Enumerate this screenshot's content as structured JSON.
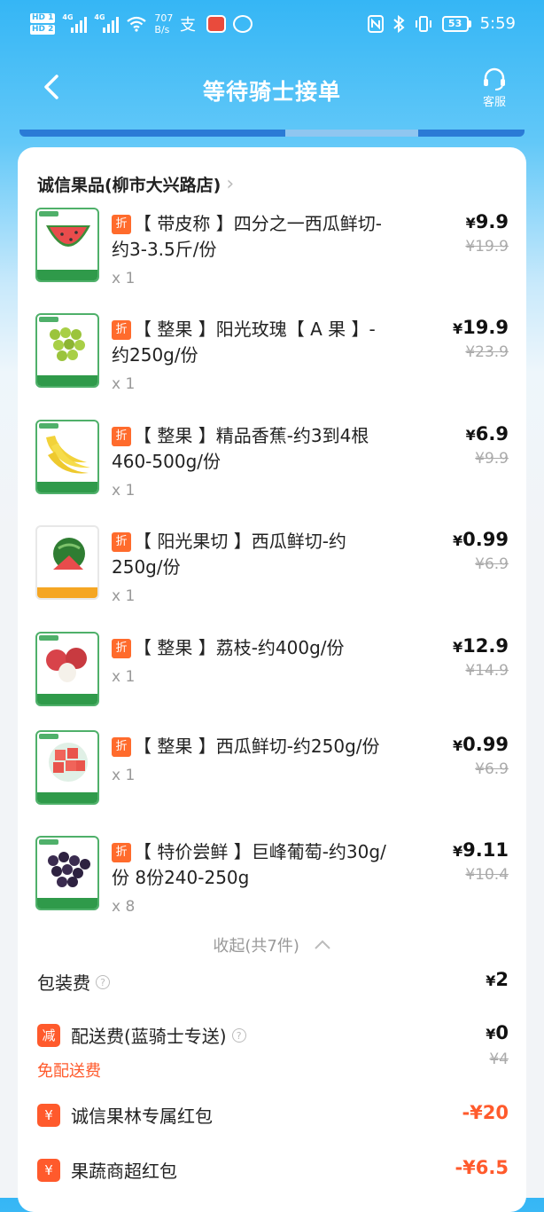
{
  "status": {
    "hd1": "HD 1",
    "hd2": "HD 2",
    "net1": "4G",
    "net2": "4G",
    "speed_value": "707",
    "speed_unit": "B/s",
    "battery": "53",
    "time": "5:59"
  },
  "nav": {
    "title": "等待骑士接单",
    "service_label": "客服"
  },
  "store": {
    "name": "诚信果品(柳市大兴路店)"
  },
  "items": [
    {
      "badge": "折",
      "name": "【 带皮称 】四分之一西瓜鲜切-约3-3.5斤/份",
      "qty": "x 1",
      "price_symbol": "¥",
      "price": "9.9",
      "orig_price": "¥19.9"
    },
    {
      "badge": "折",
      "name": "【 整果 】阳光玫瑰【 A 果 】-约250g/份",
      "qty": "x 1",
      "price_symbol": "¥",
      "price": "19.9",
      "orig_price": "¥23.9"
    },
    {
      "badge": "折",
      "name": "【 整果 】精品香蕉-约3到4根460-500g/份",
      "qty": "x 1",
      "price_symbol": "¥",
      "price": "6.9",
      "orig_price": "¥9.9"
    },
    {
      "badge": "折",
      "name": "【 阳光果切 】西瓜鲜切-约250g/份",
      "qty": "x 1",
      "price_symbol": "¥",
      "price": "0.99",
      "orig_price": "¥6.9"
    },
    {
      "badge": "折",
      "name": "【 整果 】荔枝-约400g/份",
      "qty": "x 1",
      "price_symbol": "¥",
      "price": "12.9",
      "orig_price": "¥14.9"
    },
    {
      "badge": "折",
      "name": "【 整果 】西瓜鲜切-约250g/份",
      "qty": "x 1",
      "price_symbol": "¥",
      "price": "0.99",
      "orig_price": "¥6.9"
    },
    {
      "badge": "折",
      "name": "【 特价尝鲜 】巨峰葡萄-约30g/份 8份240-250g",
      "qty": "x 8",
      "price_symbol": "¥",
      "price": "9.11",
      "orig_price": "¥10.4"
    }
  ],
  "collapse_label": "收起(共7件)",
  "fees": {
    "packing": {
      "label": "包装费",
      "symbol": "¥",
      "value": "2"
    },
    "delivery": {
      "icon": "减",
      "label": "配送费(蓝骑士专送)",
      "symbol": "¥",
      "value": "0",
      "orig": "¥4",
      "note": "免配送费"
    },
    "redpack1": {
      "icon": "¥",
      "label": "诚信果林专属红包",
      "value": "-¥20"
    },
    "redpack2": {
      "icon": "¥",
      "label": "果蔬商超红包",
      "value": "-¥6.5"
    }
  },
  "colors": {
    "accent_orange": "#ff5a2c",
    "nav_blue": "#35b6f5"
  }
}
